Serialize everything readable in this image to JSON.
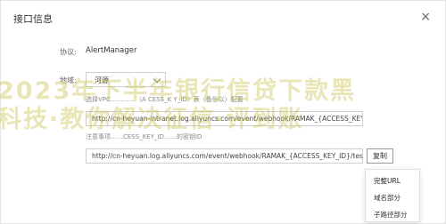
{
  "dialog": {
    "title": "接口信息",
    "close_glyph": "×"
  },
  "fields": {
    "protocol_label": "协议:",
    "protocol_value": "AlertManager",
    "region_label": "地域:",
    "region_value": "河源",
    "hint_intranet": "选择VPC…………（A  CESS_K  Y_ID）表（备份以）配置",
    "hint_intranet_link": "配置",
    "url_intranet": "http://cn-heyuan-intranet.log.aliyuncs.com/event/webhook/RAMAK_{ACCESS_KEY_ID}/",
    "hint_public": "注意事项……CESS_KEY_ID……的密钥ID",
    "hint_public_link": "密钥ID",
    "url_public": "http://cn-heyuan.log.aliyuncs.com/event/webhook/RAMAK_{ACCESS_KEY_ID}/test_an",
    "copy_label": "复制"
  },
  "dropdown": {
    "items": [
      "完整URL",
      "域名部分",
      "子路径部分"
    ]
  },
  "watermark": {
    "line1": "2023年下半年银行信贷下款黑",
    "line2": "科技·教你解决征信·评到账"
  }
}
